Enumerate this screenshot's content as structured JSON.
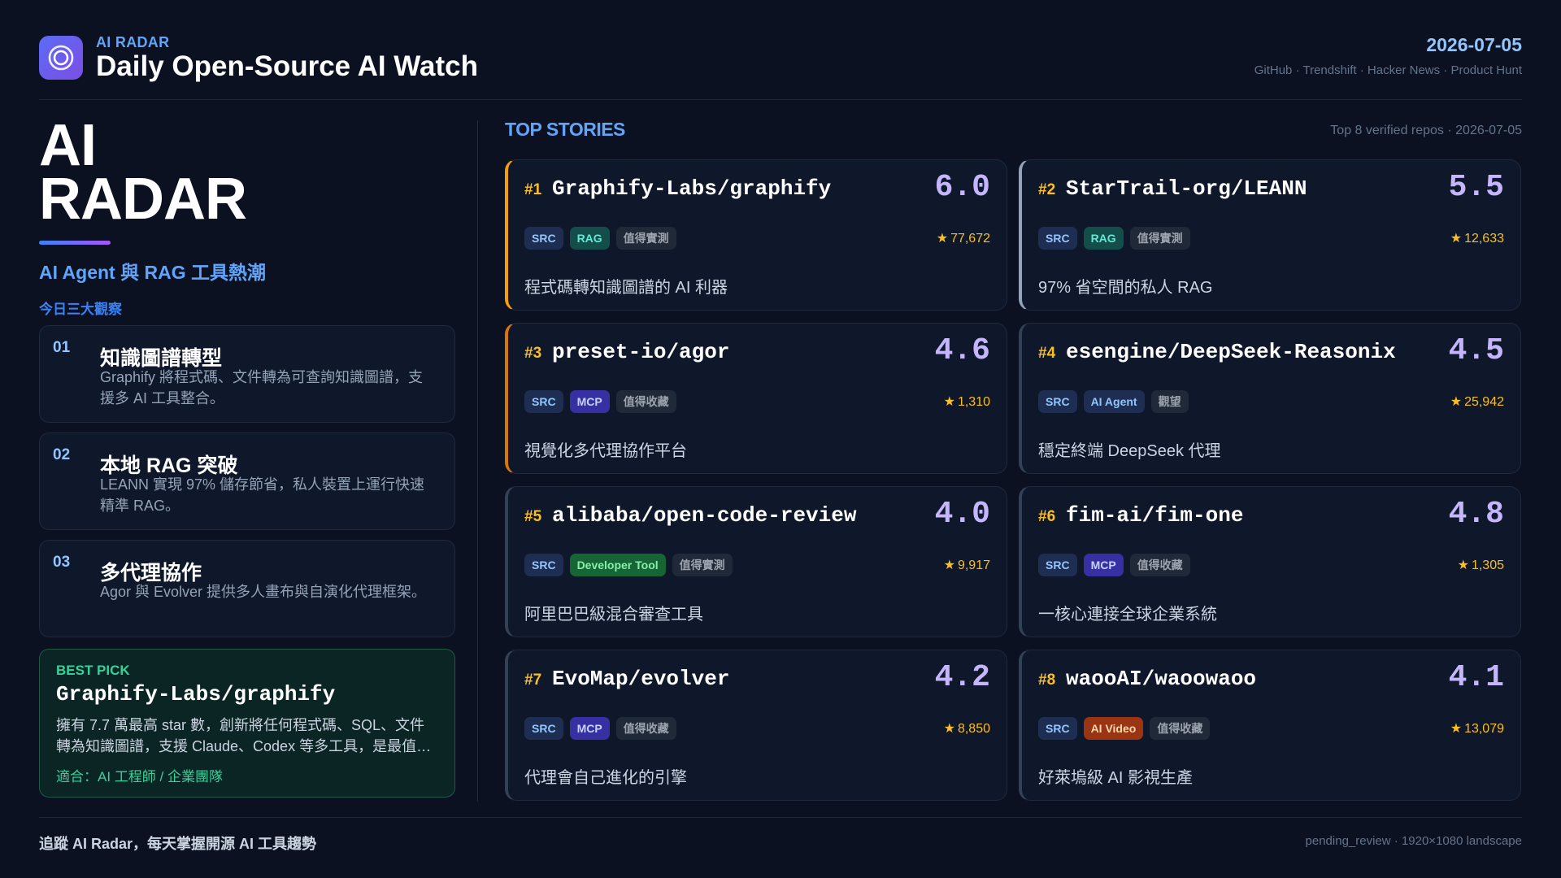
{
  "header": {
    "brand_small": "AI RADAR",
    "title": "Daily Open-Source AI Watch",
    "date": "2026-07-05",
    "sources": "GitHub · Trendshift · Hacker News · Product Hunt",
    "logo_icon": "radar-target-icon"
  },
  "left": {
    "hero_line1": "AI",
    "hero_line2": "RADAR",
    "subtitle": "AI Agent 與 RAG 工具熱潮",
    "insights_heading": "今日三大觀察",
    "insights": [
      {
        "num": "01",
        "title": "知識圖譜轉型",
        "desc": "Graphify 將程式碼、文件轉為可查詢知識圖譜，支援多 AI 工具整合。"
      },
      {
        "num": "02",
        "title": "本地 RAG 突破",
        "desc": "LEANN 實現 97% 儲存節省，私人裝置上運行快速精準 RAG。"
      },
      {
        "num": "03",
        "title": "多代理協作",
        "desc": "Agor 與 Evolver 提供多人畫布與自演化代理框架。"
      }
    ],
    "best_pick": {
      "label": "BEST PICK",
      "repo": "Graphify-Labs/graphify",
      "desc": "擁有 7.7 萬最高 star 數，創新將任何程式碼、SQL、文件轉為知識圖譜，支援 Claude、Codex 等多工具，是最值得關注的開源 AI 工具。",
      "fit": "適合：AI 工程師 / 企業團隊"
    }
  },
  "top_stories": {
    "title": "TOP STORIES",
    "meta": "Top 8 verified repos · 2026-07-05",
    "cards": [
      {
        "rank": "#1",
        "repo": "Graphify-Labs/graphify",
        "score": "6.0",
        "tags": [
          "SRC",
          "RAG",
          "值得實測"
        ],
        "stars": "77,672",
        "desc": "程式碼轉知識圖譜的 AI 利器",
        "accent": "#f59e0b"
      },
      {
        "rank": "#2",
        "repo": "StarTrail-org/LEANN",
        "score": "5.5",
        "tags": [
          "SRC",
          "RAG",
          "值得實測"
        ],
        "stars": "12,633",
        "desc": "97% 省空間的私人 RAG",
        "accent": "#94a3b8"
      },
      {
        "rank": "#3",
        "repo": "preset-io/agor",
        "score": "4.6",
        "tags": [
          "SRC",
          "MCP",
          "值得收藏"
        ],
        "stars": "1,310",
        "desc": "視覺化多代理協作平台",
        "accent": "#d97706"
      },
      {
        "rank": "#4",
        "repo": "esengine/DeepSeek-Reasonix",
        "score": "4.5",
        "tags": [
          "SRC",
          "AI Agent",
          "觀望"
        ],
        "stars": "25,942",
        "desc": "穩定終端 DeepSeek 代理",
        "accent": "#334155"
      },
      {
        "rank": "#5",
        "repo": "alibaba/open-code-review",
        "score": "4.0",
        "tags": [
          "SRC",
          "Developer Tool",
          "值得實測"
        ],
        "stars": "9,917",
        "desc": "阿里巴巴級混合審查工具",
        "accent": "#334155"
      },
      {
        "rank": "#6",
        "repo": "fim-ai/fim-one",
        "score": "4.8",
        "tags": [
          "SRC",
          "MCP",
          "值得收藏"
        ],
        "stars": "1,305",
        "desc": "一核心連接全球企業系統",
        "accent": "#334155"
      },
      {
        "rank": "#7",
        "repo": "EvoMap/evolver",
        "score": "4.2",
        "tags": [
          "SRC",
          "MCP",
          "值得收藏"
        ],
        "stars": "8,850",
        "desc": "代理會自己進化的引擎",
        "accent": "#334155"
      },
      {
        "rank": "#8",
        "repo": "waooAI/waoowaoo",
        "score": "4.1",
        "tags": [
          "SRC",
          "AI Video",
          "值得收藏"
        ],
        "stars": "13,079",
        "desc": "好萊塢級 AI 影視生產",
        "accent": "#334155"
      }
    ],
    "tag_styles": {
      "SRC": "src",
      "RAG": "rag",
      "MCP": "mcp",
      "AI Agent": "agent",
      "Developer Tool": "dev",
      "AI Video": "video"
    },
    "rank_color": "#fbbf24",
    "star_icon": "star-icon",
    "star_glyph": "★"
  },
  "footer": {
    "left": "追蹤 AI Radar，每天掌握開源 AI 工具趨勢",
    "right": "pending_review · 1920×1080 landscape"
  }
}
